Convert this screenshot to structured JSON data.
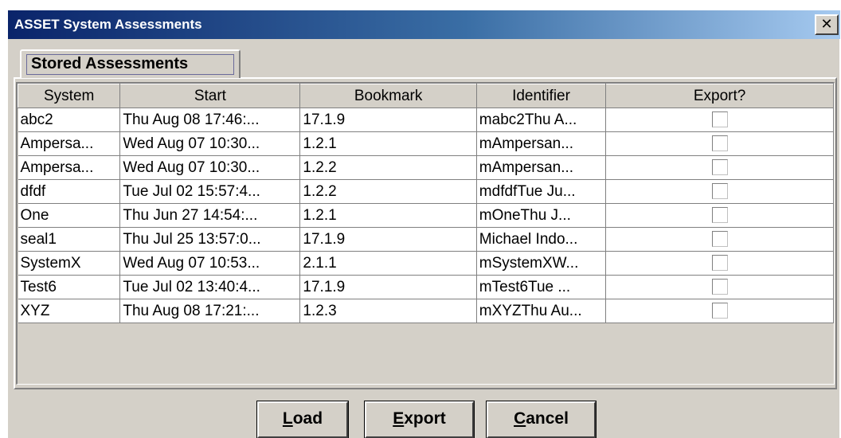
{
  "window": {
    "title": "ASSET System Assessments",
    "close_symbol": "✕"
  },
  "tab": {
    "label": "Stored Assessments"
  },
  "table": {
    "columns": [
      "System",
      "Start",
      "Bookmark",
      "Identifier",
      "Export?"
    ],
    "rows": [
      {
        "system": "abc2",
        "start": "Thu Aug 08 17:46:...",
        "bookmark": "17.1.9",
        "identifier": "mabc2Thu A...",
        "export": false
      },
      {
        "system": "Ampersa...",
        "start": "Wed Aug 07 10:30...",
        "bookmark": "1.2.1",
        "identifier": "mAmpersan...",
        "export": false
      },
      {
        "system": "Ampersa...",
        "start": "Wed Aug 07 10:30...",
        "bookmark": "1.2.2",
        "identifier": "mAmpersan...",
        "export": false
      },
      {
        "system": "dfdf",
        "start": "Tue Jul 02 15:57:4...",
        "bookmark": "1.2.2",
        "identifier": "mdfdfTue Ju...",
        "export": false
      },
      {
        "system": "One",
        "start": "Thu Jun 27 14:54:...",
        "bookmark": "1.2.1",
        "identifier": "mOneThu J...",
        "export": false
      },
      {
        "system": "seal1",
        "start": "Thu Jul 25 13:57:0...",
        "bookmark": "17.1.9",
        "identifier": "Michael Indo...",
        "export": false
      },
      {
        "system": "SystemX",
        "start": "Wed Aug 07 10:53...",
        "bookmark": "2.1.1",
        "identifier": "mSystemXW...",
        "export": false
      },
      {
        "system": "Test6",
        "start": "Tue Jul 02 13:40:4...",
        "bookmark": "17.1.9",
        "identifier": "mTest6Tue ...",
        "export": false
      },
      {
        "system": "XYZ",
        "start": "Thu Aug 08 17:21:...",
        "bookmark": "1.2.3",
        "identifier": "mXYZThu Au...",
        "export": false
      }
    ]
  },
  "buttons": {
    "load": {
      "first": "L",
      "rest": "oad"
    },
    "export": {
      "first": "E",
      "rest": "xport"
    },
    "cancel": {
      "first": "C",
      "rest": "ancel"
    }
  },
  "colors": {
    "title_gradient_start": "#0a246a",
    "title_gradient_end": "#a6caf0",
    "face": "#d4d0c8"
  }
}
